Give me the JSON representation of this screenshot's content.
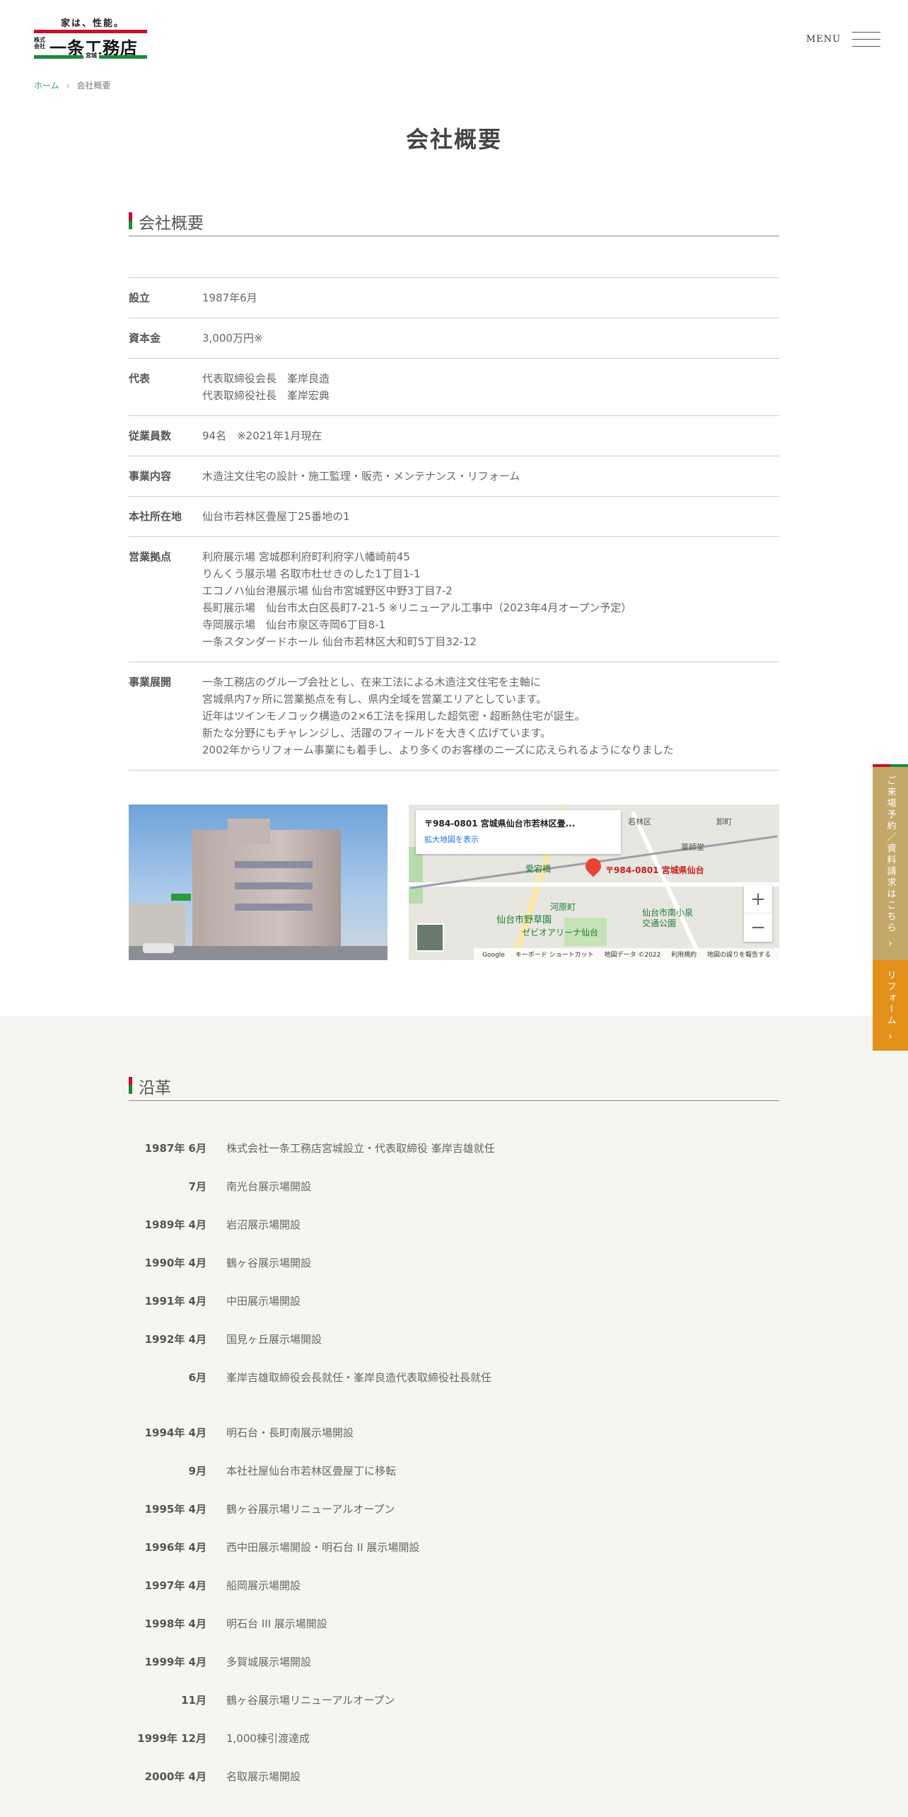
{
  "header": {
    "logo_tagline": "家は、性能。",
    "logo_corp_small": "株式会社",
    "logo_name": "一条工務店",
    "logo_branch": "宮城",
    "menu_label": "MENU"
  },
  "breadcrumb": {
    "home": "ホーム",
    "separator": "›",
    "current": "会社概要"
  },
  "page_title": "会社概要",
  "company": {
    "heading": "会社概要",
    "rows": [
      {
        "label": "設立",
        "value": "1987年6月"
      },
      {
        "label": "資本金",
        "value": "3,000万円※"
      },
      {
        "label": "代表",
        "value": "代表取締役会長　峯岸良造\n代表取締役社長　峯岸宏典"
      },
      {
        "label": "従業員数",
        "value": "94名　※2021年1月現在"
      },
      {
        "label": "事業内容",
        "value": "木造注文住宅の設計・施工監理・販売・メンテナンス・リフォーム"
      },
      {
        "label": "本社所在地",
        "value": "仙台市若林区畳屋丁25番地の1"
      },
      {
        "label": "営業拠点",
        "value": "利府展示場 宮城郡利府町利府字八幡崎前45\nりんくう展示場 名取市杜せきのした1丁目1-1\nエコノハ仙台港展示場 仙台市宮城野区中野3丁目7-2\n長町展示場　仙台市太白区長町7-21-5 ※リニューアル工事中（2023年4月オープン予定）\n寺岡展示場　仙台市泉区寺岡6丁目8-1\n一条スタンダードホール 仙台市若林区大和町5丁目32-12"
      },
      {
        "label": "事業展開",
        "value": "一条工務店のグループ会社とし、在来工法による木造注文住宅を主軸に\n宮城県内7ヶ所に営業拠点を有し、県内全域を営業エリアとしています。\n近年はツインモノコック構造の2×6工法を採用した超気密・超断熱住宅が誕生。\n新たな分野にもチャレンジし、活躍のフィールドを大きく広げています。\n2002年からリフォーム事業にも着手し、より多くのお客様のニーズに応えられるようになりました"
      }
    ]
  },
  "map": {
    "info_address": "〒984-0801 宮城県仙台市若林区畳...",
    "info_link": "拡大地図を表示",
    "pin_label": "〒984-0801 宮城県仙台",
    "places": [
      "愛宕橋",
      "河原町",
      "仙台市野草園",
      "仙台市南小泉交通公園",
      "ゼビオアリーナ仙台",
      "若林区",
      "薬師堂",
      "卸町"
    ],
    "zoom_in": "+",
    "zoom_out": "−",
    "attribution": [
      "Google",
      "キーボード ショートカット",
      "地図データ ©2022",
      "利用規約",
      "地図の誤りを報告する"
    ]
  },
  "side_cta": {
    "visit": "ご来場予約／資料請求はこちら",
    "reform": "リフォーム",
    "arrow": "›"
  },
  "history": {
    "heading": "沿革",
    "items": [
      {
        "date": "1987年 6月",
        "event": "株式会社一条工務店宮城設立・代表取締役 峯岸吉雄就任"
      },
      {
        "date": "7月",
        "event": "南光台展示場開設"
      },
      {
        "date": "1989年 4月",
        "event": "岩沼展示場開設"
      },
      {
        "date": "1990年 4月",
        "event": "鶴ヶ谷展示場開設"
      },
      {
        "date": "1991年 4月",
        "event": "中田展示場開設"
      },
      {
        "date": "1992年 4月",
        "event": "国見ヶ丘展示場開設"
      },
      {
        "date": "6月",
        "event": "峯岸吉雄取締役会長就任・峯岸良造代表取締役社長就任"
      },
      {
        "date": "1994年 4月",
        "event": "明石台・長町南展示場開設"
      },
      {
        "date": "9月",
        "event": "本社社屋仙台市若林区畳屋丁に移転"
      },
      {
        "date": "1995年 4月",
        "event": "鶴ヶ谷展示場リニューアルオープン"
      },
      {
        "date": "1996年 4月",
        "event": "西中田展示場開設・明石台 II 展示場開設"
      },
      {
        "date": "1997年 4月",
        "event": "船岡展示場開設"
      },
      {
        "date": "1998年 4月",
        "event": "明石台 III 展示場開設"
      },
      {
        "date": "1999年 4月",
        "event": "多賀城展示場開設"
      },
      {
        "date": "11月",
        "event": "鶴ヶ谷展示場リニューアルオープン"
      },
      {
        "date": "1999年 12月",
        "event": "1,000棟引渡達成"
      },
      {
        "date": "2000年 4月",
        "event": "名取展示場開設"
      }
    ]
  }
}
